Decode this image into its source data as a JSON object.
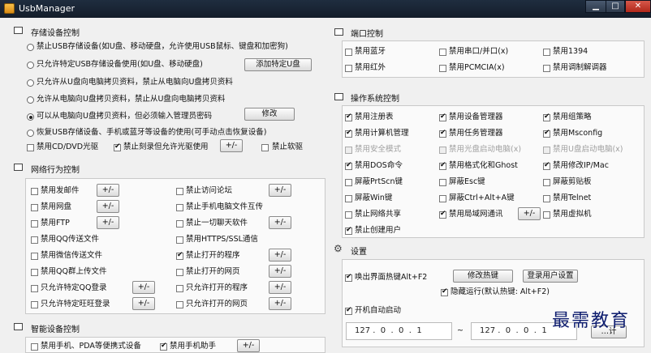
{
  "window": {
    "title": "UsbManager",
    "minimize": "▁",
    "maximize": "□",
    "close": "✕"
  },
  "storage": {
    "title": "存储设备控制",
    "options": [
      "禁止USB存储设备(如U盘、移动硬盘，允许使用USB鼠标、键盘和加密狗)",
      "只允许特定USB存储设备使用(如U盘、移动硬盘)",
      "只允许从U盘向电脑拷贝资料，禁止从电脑向U盘拷贝资料",
      "允许从电脑向U盘拷贝资料，禁止从U盘向电脑拷贝资料",
      "可以从电脑向U盘拷贝资料，但必须输入管理员密码",
      "恢复USB存储设备、手机或蓝牙等设备的使用(可手动点击恢复设备)"
    ],
    "add_button": "添加特定U盘",
    "modify_button": "修改",
    "cd_label": "禁用CD/DVD光驱",
    "burn_label": "禁止刻录但允许光驱使用",
    "plusminus": "+/-",
    "floppy_label": "禁止软驱"
  },
  "network": {
    "title": "网络行为控制",
    "plusminus": "+/-",
    "items": [
      "禁用发邮件",
      "禁止访问论坛",
      "禁用网盘",
      "禁止手机电脑文件互传",
      "禁用FTP",
      "禁止一切聊天软件",
      "禁用QQ传送文件",
      "禁用HTTPS/SSL通信",
      "禁用微信传送文件",
      "禁止打开的程序",
      "禁用QQ群上传文件",
      "禁止打开的网页",
      "只允许特定QQ登录",
      "只允许打开的程序",
      "只允许特定旺旺登录",
      "只允许打开的网页"
    ]
  },
  "smart": {
    "title": "智能设备控制",
    "items": [
      "禁用手机、PDA等便携式设备",
      "禁用手机助手"
    ],
    "plusminus": "+/-"
  },
  "port": {
    "title": "端口控制",
    "items": [
      "禁用蓝牙",
      "禁用串口/并口(x)",
      "禁用1394",
      "禁用红外",
      "禁用PCMCIA(x)",
      "禁用调制解调器"
    ]
  },
  "os": {
    "title": "操作系统控制",
    "items": [
      "禁用注册表",
      "禁用设备管理器",
      "禁用组策略",
      "禁用计算机管理",
      "禁用任务管理器",
      "禁用Msconfig",
      "禁用安全模式",
      "禁用光盘启动电脑(x)",
      "禁用U盘启动电脑(x)",
      "禁用DOS命令",
      "禁用格式化和Ghost",
      "禁用修改IP/Mac",
      "屏蔽PrtScn键",
      "屏蔽Esc键",
      "屏蔽剪贴板",
      "屏蔽Win键",
      "屏蔽Ctrl+Alt+A键",
      "禁用Telnet",
      "禁止网络共享",
      "禁用局域网通讯",
      "禁用虚拟机",
      "禁止创建用户"
    ],
    "plusminus": "+/-"
  },
  "settings": {
    "title": "设置",
    "hotkey_label": "唤出界面热键Alt+F2",
    "modify_hotkey": "修改热键",
    "login_settings": "登录用户设置",
    "hidden_label": "隐藏运行(默认热键: Alt+F2)",
    "autostart_label": "开机自动启动",
    "ip_from": "127 .  0  .  0  .  1",
    "tilde": "~",
    "ip_to": "127 .  0  .  0  .  1",
    "partial_button": "…计"
  },
  "watermark": "最需教育"
}
